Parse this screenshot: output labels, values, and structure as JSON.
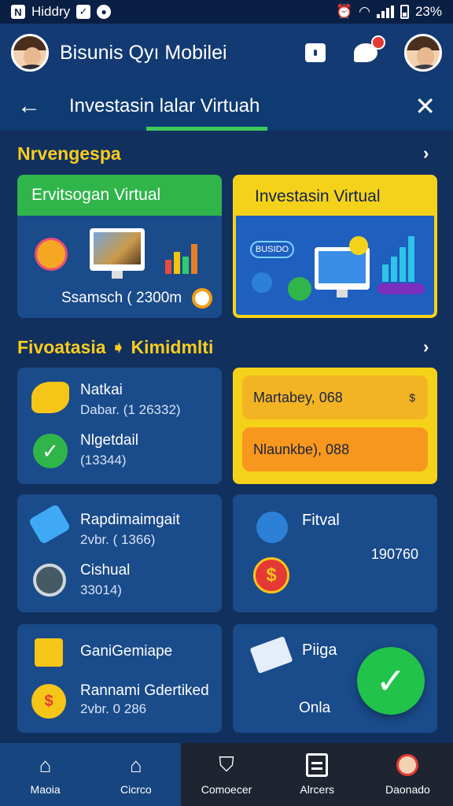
{
  "status_bar": {
    "left_text": "Hiddry",
    "battery": "23%"
  },
  "header": {
    "title": "Bisunis Qyı Mobilei"
  },
  "subheader": {
    "title": "Investasin lalar Virtuah"
  },
  "section1": {
    "title": "Nrvengespa",
    "card_left": {
      "title": "Ervitsogan Virtual",
      "footer": "Ssamsch ( 2300m"
    },
    "card_right": {
      "title": "Investasin Virtual",
      "chip": "BUSIDO"
    }
  },
  "section2": {
    "title": "Fivoatasia ➧ Kimidmlti",
    "card_a": {
      "row1_main": "Natkai",
      "row1_sub": "Dabar. (1 26332)",
      "row2_main": "Nlgetdail",
      "row2_sub": "(13344)"
    },
    "card_b": {
      "pill1": "Martabey, 068",
      "pill2": "Nlaunkbe), 088"
    },
    "card_c": {
      "row1_main": "Rapdimaimgait",
      "row1_sub": "2vbr. ( 1366)",
      "row2_main": "Cishual",
      "row2_sub": "33014)"
    },
    "card_d": {
      "title": "Fitval",
      "value": "190760"
    },
    "card_e": {
      "row1_main": "GaniGemiape",
      "row2_main": "Rannami Gdertiked",
      "row2_sub": "2vbr. 0 286"
    },
    "card_f": {
      "title": "Piiga",
      "footer": "Onla"
    }
  },
  "bottom_nav": [
    {
      "label": "Maoia"
    },
    {
      "label": "Cicrco"
    },
    {
      "label": "Comoecer"
    },
    {
      "label": "Alrcers"
    },
    {
      "label": "Daonado"
    }
  ],
  "colors": {
    "accent_green": "#2fb54a",
    "accent_yellow": "#f5d21a",
    "navy": "#12305e"
  }
}
